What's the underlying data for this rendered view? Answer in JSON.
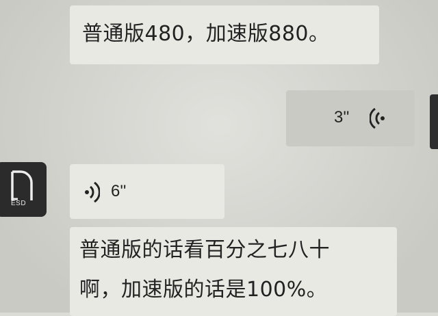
{
  "messages": [
    {
      "direction": "incoming",
      "type": "text",
      "text": "普通版480，加速版880。"
    },
    {
      "direction": "outgoing",
      "type": "voice",
      "duration": "3''"
    },
    {
      "direction": "incoming",
      "type": "voice",
      "duration": "6''"
    },
    {
      "direction": "incoming",
      "type": "text",
      "lines": [
        "普通版的话看百分之七八十",
        "啊，加速版的话是100%。"
      ]
    }
  ],
  "avatar": {
    "label": "ESD",
    "icon": "brand-logo-icon"
  },
  "icons": {
    "voice_outgoing": "voice-wave-left-icon",
    "voice_incoming": "voice-wave-right-icon"
  },
  "colors": {
    "background": "#d7d7d1",
    "incoming_bubble": "#e9e9e4",
    "outgoing_bubble": "#cacac4"
  }
}
